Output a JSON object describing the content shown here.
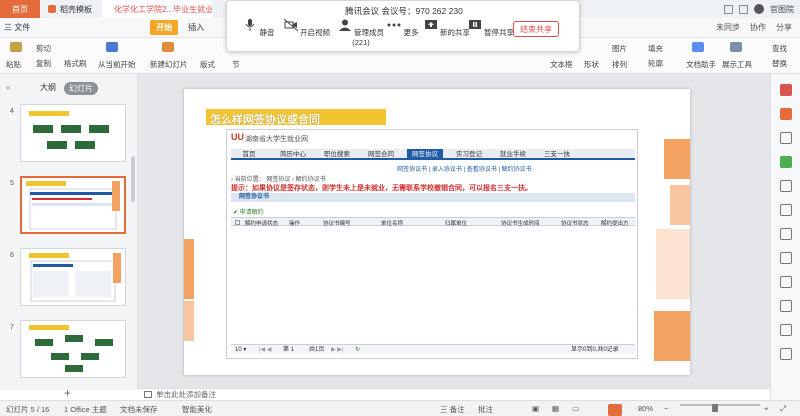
{
  "titlebar": {
    "tabs": [
      {
        "label": "首页"
      },
      {
        "label": "稻壳模板"
      },
      {
        "label": "化学化工学院2...毕业生就业网"
      }
    ],
    "user_name": "官图院"
  },
  "menubar": {
    "file": "三 文件",
    "start": "开始",
    "insert": "插入",
    "right": [
      "未同步",
      "协作",
      "分享"
    ]
  },
  "ribbon": {
    "paste": "粘贴",
    "cut": "剪切",
    "copy": "复制",
    "format_painter": "格式刷",
    "play_from_current": "从当前开始",
    "new_slide": "新建幻灯片",
    "layout": "版式",
    "section": "节",
    "text_box": "文本框",
    "shapes": "形状",
    "arrange": "排列",
    "image": "图片",
    "fill": "填充",
    "outline": "轮廓",
    "assistant": "文档助手",
    "presentation_tools": "展示工具",
    "find": "查找",
    "replace": "替换"
  },
  "meeting": {
    "title": "腾讯会议  会议号：970 262 230",
    "buttons": [
      {
        "label": "静音"
      },
      {
        "label": "开启视频"
      },
      {
        "label": "管理成员(221)"
      },
      {
        "label": "更多"
      },
      {
        "label": "新的共享"
      },
      {
        "label": "暂停共享"
      }
    ],
    "end_share": "结束共享"
  },
  "leftpanel": {
    "tab_outline": "大纲",
    "tab_slides": "幻灯片",
    "thumbnails": [
      {
        "num": "4"
      },
      {
        "num": "5"
      },
      {
        "num": "6"
      },
      {
        "num": "7"
      }
    ],
    "add_label": "+"
  },
  "slide": {
    "title": "怎么样网签协议或合同",
    "web": {
      "logo_mark": "UU",
      "logo_text": "湖南省大学生就业网",
      "nav": [
        "首页",
        "简历中心",
        "职位搜索",
        "网签合同",
        "网签协议",
        "实习登记",
        "就业手续",
        "三支一扶"
      ],
      "active_nav": "网签协议",
      "subnav": "网签协议书  |  录入协议书  |  查看协议书  |  解约协议书",
      "breadcrumb": "› 当前位置：  网签协议  ›  解约协议书",
      "tip": "提示：如果协议是签存状态，则学生未上是未就业，无需联系学校撤销合同，可以报名三支一扶。",
      "panel_title": "网签协议书",
      "toolbar_add": "申请解约",
      "columns": [
        "解约申请状态",
        "操作",
        "协议书编号",
        "单位名称",
        "归属单位",
        "协议书生成时间",
        "协议书状态",
        "解约提出方"
      ],
      "pager": {
        "page_size": "10 ▾",
        "page_label": "第 1",
        "of_pages": "共1页",
        "summary": "显示0到0,共0记录"
      }
    }
  },
  "notes": "单击此处添加备注",
  "statusbar": {
    "slide_info": "幻灯片 5 / 16",
    "theme": "1 Office 主题",
    "doc_unsaved": "文档未保存",
    "smart_beautify": "智能美化",
    "notes": "三 备注",
    "comments": "批注",
    "zoom": "80%"
  }
}
